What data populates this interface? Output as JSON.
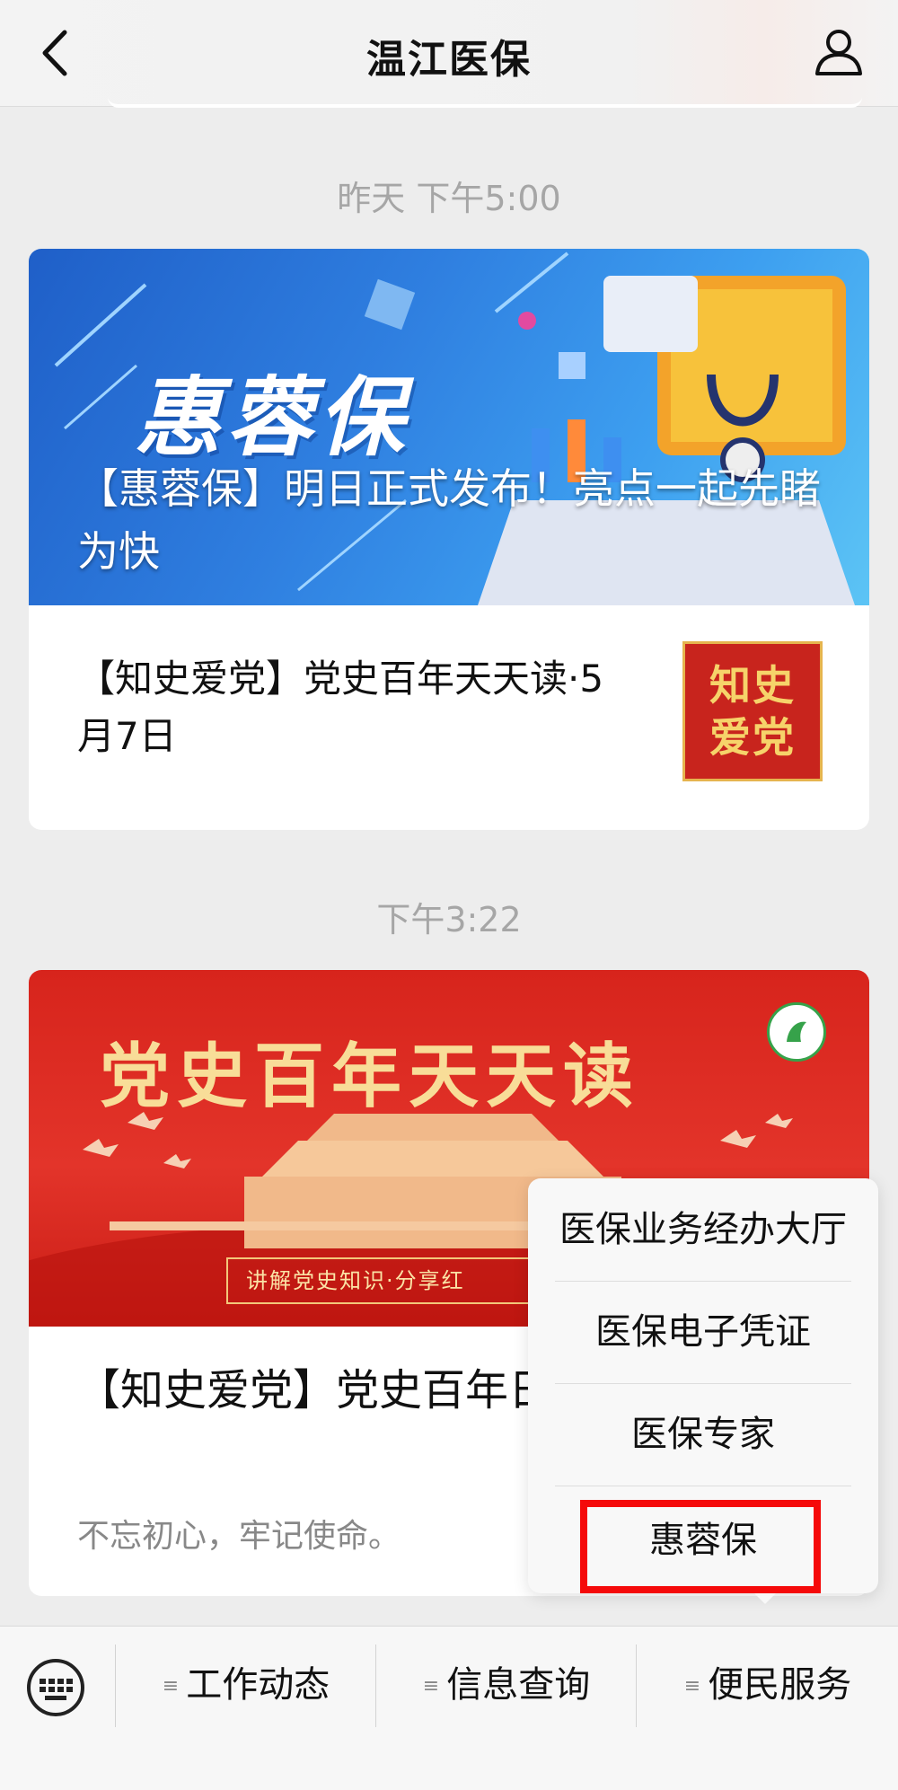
{
  "header": {
    "title": "温江医保",
    "back_icon": "chevron-left-icon",
    "profile_icon": "person-icon"
  },
  "messages": [
    {
      "timestamp": "昨天 下午5:00",
      "banner_logo": "惠蓉保",
      "banner_title": "【惠蓉保】明日正式发布！亮点一起先睹为快",
      "sub_item": {
        "title": "【知史爱党】党史百年天天读·5月7日",
        "thumb_text_1": "知史",
        "thumb_text_2": "爱党"
      }
    },
    {
      "timestamp": "下午3:22",
      "banner_title": "党史百年天天读",
      "banner_strip": "讲解党史知识·分享红",
      "title": "【知史爱党】党史百年日",
      "desc": "不忘初心，牢记使命。"
    }
  ],
  "popup_menu": {
    "items": [
      "医保业务经办大厅",
      "医保电子凭证",
      "医保专家",
      "惠蓉保"
    ],
    "highlighted_index": 3,
    "highlight_color": "#f50a0a"
  },
  "bottom_menu": {
    "keyboard_icon": "keyboard-icon",
    "tabs": [
      "工作动态",
      "信息查询",
      "便民服务"
    ]
  }
}
